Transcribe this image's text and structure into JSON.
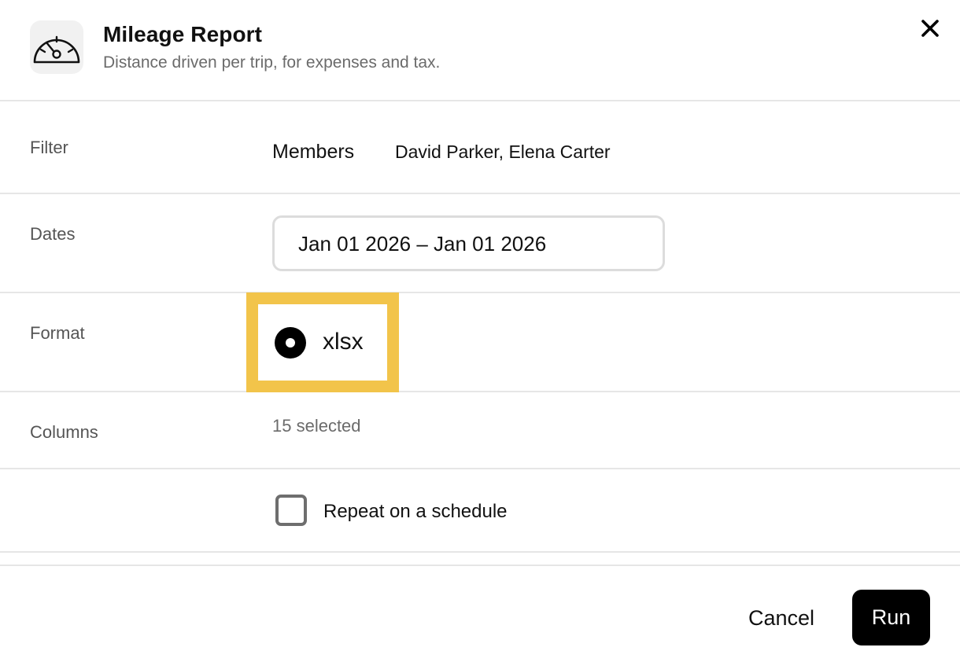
{
  "header": {
    "icon": "speedometer-icon",
    "title": "Mileage Report",
    "subtitle": "Distance driven per trip, for expenses and tax.",
    "close_icon": "close-icon"
  },
  "filter": {
    "label": "Filter",
    "key": "Members",
    "value": "David Parker, Elena Carter"
  },
  "dates": {
    "label": "Dates",
    "value": "Jan 01 2026 – Jan 01 2026"
  },
  "format": {
    "label": "Format",
    "option": "xlsx",
    "selected": true,
    "highlight_color": "#f2c44a"
  },
  "columns": {
    "label": "Columns",
    "value": "15 selected"
  },
  "schedule": {
    "label": "Repeat on a schedule",
    "checked": false
  },
  "footer": {
    "cancel_label": "Cancel",
    "run_label": "Run"
  }
}
